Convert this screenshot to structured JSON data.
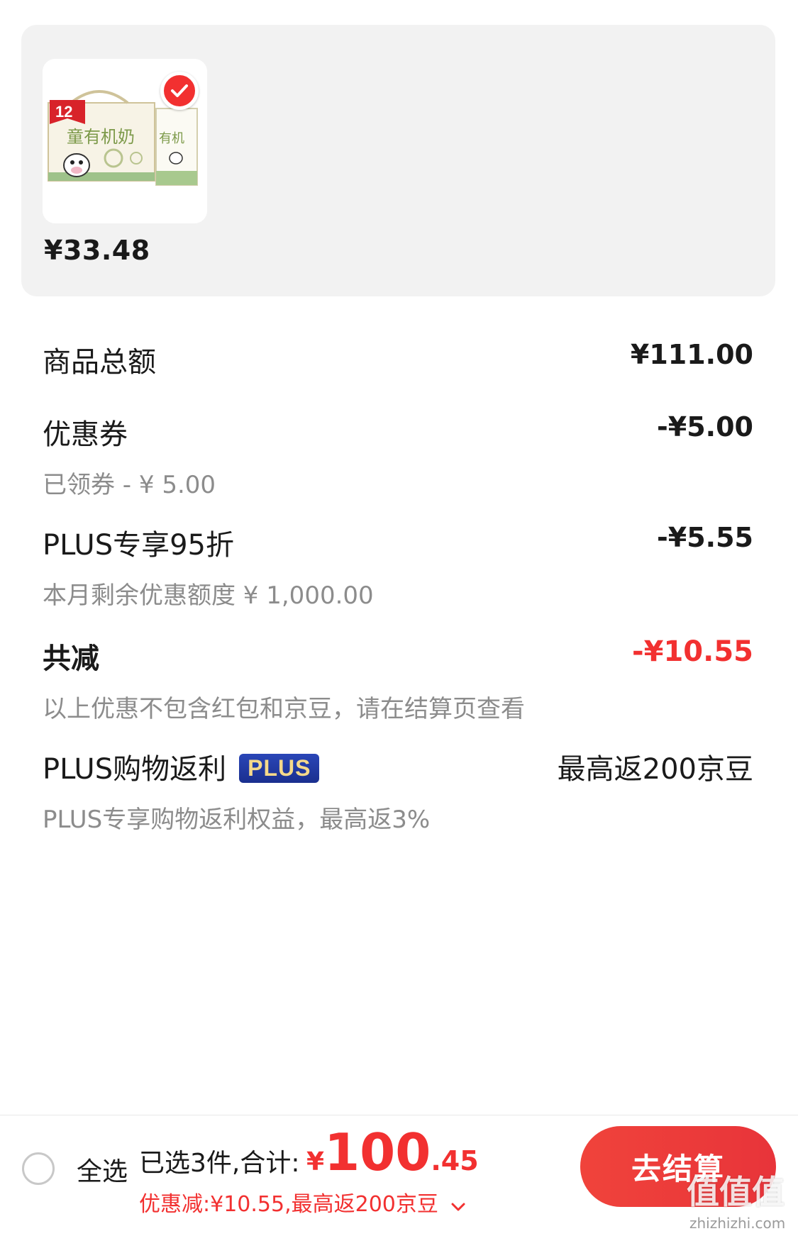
{
  "product": {
    "price": "¥33.48",
    "badge_count": "12",
    "image_text": "童有机奶"
  },
  "summary": {
    "goods_total": {
      "label": "商品总额",
      "amount": "¥111.00"
    },
    "coupon": {
      "label": "优惠券",
      "amount": "-¥5.00",
      "sub": "已领券 - ¥ 5.00"
    },
    "plus_discount": {
      "label": "PLUS专享95折",
      "amount": "-¥5.55",
      "sub": "本月剩余优惠额度 ¥ 1,000.00"
    },
    "total_reduce": {
      "label": "共减",
      "amount": "-¥10.55",
      "sub": "以上优惠不包含红包和京豆，请在结算页查看"
    },
    "plus_rebate": {
      "label": "PLUS购物返利",
      "badge": "PLUS",
      "amount": "最高返200京豆",
      "sub": "PLUS专享购物返利权益，最高返3%"
    }
  },
  "bottom_bar": {
    "select_all": "全选",
    "selected": "已选3件,合计:",
    "currency": "¥",
    "total_int": "100",
    "total_dec": ".45",
    "discount_line": "优惠减:¥10.55,最高返200京豆",
    "checkout": "去结算",
    "watermark": "值值值",
    "watermark_url": "zhizhizhi.com"
  },
  "colors": {
    "accent_red": "#f23030",
    "card_bg": "#f2f2f2",
    "plus_blue": "#1a2f8f",
    "plus_gold": "#f6d98a"
  }
}
